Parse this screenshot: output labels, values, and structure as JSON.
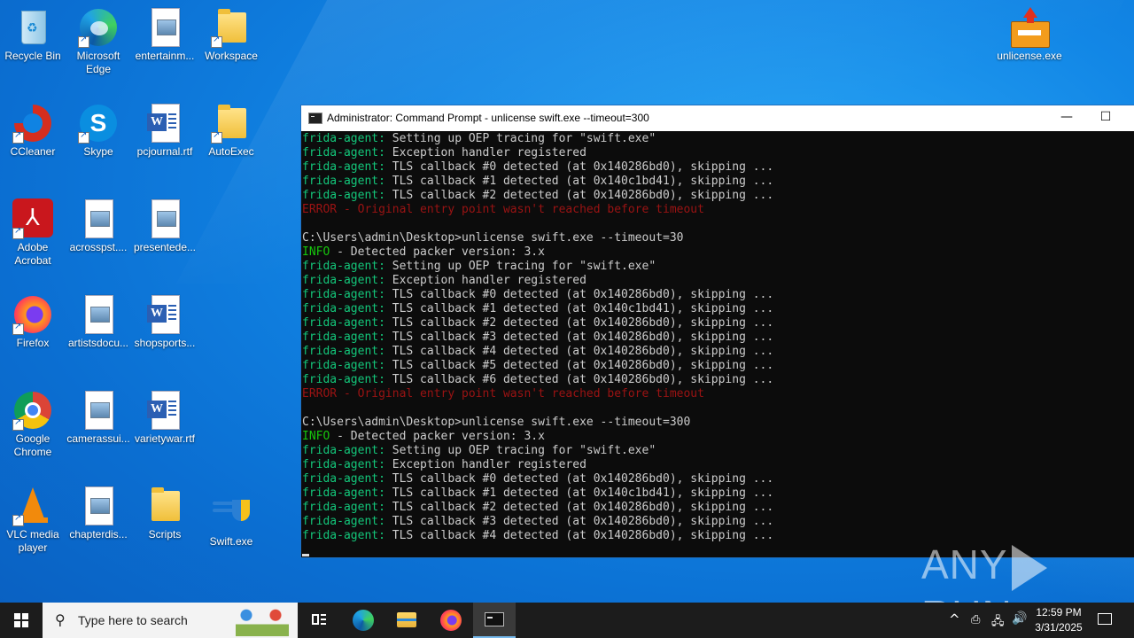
{
  "desktop": {
    "icons": [
      {
        "label": "Recycle Bin"
      },
      {
        "label": "Microsoft Edge"
      },
      {
        "label": "entertainm..."
      },
      {
        "label": "Workspace"
      },
      {
        "label": "CCleaner"
      },
      {
        "label": "Skype"
      },
      {
        "label": "pcjournal.rtf"
      },
      {
        "label": "AutoExec"
      },
      {
        "label": "Adobe Acrobat"
      },
      {
        "label": "acrosspst...."
      },
      {
        "label": "presentede..."
      },
      {
        "label": "Firefox"
      },
      {
        "label": "artistsdocu..."
      },
      {
        "label": "shopsports..."
      },
      {
        "label": "Google Chrome"
      },
      {
        "label": "camerassui..."
      },
      {
        "label": "varietywar.rtf"
      },
      {
        "label": "VLC media player"
      },
      {
        "label": "chapterdis..."
      },
      {
        "label": "Scripts"
      },
      {
        "label": "Swift.exe"
      },
      {
        "label": "unlicense.exe"
      }
    ]
  },
  "cmd_window": {
    "title": "Administrator: Command Prompt - unlicense  swift.exe --timeout=300",
    "minimize": "—",
    "maximize": "☐",
    "lines": [
      {
        "prefix": "frida-agent:",
        "text": " Setting up OEP tracing for \"swift.exe\"",
        "type": "agent"
      },
      {
        "prefix": "frida-agent:",
        "text": " Exception handler registered",
        "type": "agent"
      },
      {
        "prefix": "frida-agent:",
        "text": " TLS callback #0 detected (at 0x140286bd0), skipping ...",
        "type": "agent"
      },
      {
        "prefix": "frida-agent:",
        "text": " TLS callback #1 detected (at 0x140c1bd41), skipping ...",
        "type": "agent"
      },
      {
        "prefix": "frida-agent:",
        "text": " TLS callback #2 detected (at 0x140286bd0), skipping ...",
        "type": "agent"
      },
      {
        "prefix": "",
        "text": "ERROR - Original entry point wasn't reached before timeout",
        "type": "error"
      },
      {
        "prefix": "",
        "text": "",
        "type": "plain"
      },
      {
        "prefix": "",
        "text": "C:\\Users\\admin\\Desktop>unlicense swift.exe --timeout=30",
        "type": "plain"
      },
      {
        "prefix": "INFO",
        "text": " - Detected packer version: 3.x",
        "type": "info"
      },
      {
        "prefix": "frida-agent:",
        "text": " Setting up OEP tracing for \"swift.exe\"",
        "type": "agent"
      },
      {
        "prefix": "frida-agent:",
        "text": " Exception handler registered",
        "type": "agent"
      },
      {
        "prefix": "frida-agent:",
        "text": " TLS callback #0 detected (at 0x140286bd0), skipping ...",
        "type": "agent"
      },
      {
        "prefix": "frida-agent:",
        "text": " TLS callback #1 detected (at 0x140c1bd41), skipping ...",
        "type": "agent"
      },
      {
        "prefix": "frida-agent:",
        "text": " TLS callback #2 detected (at 0x140286bd0), skipping ...",
        "type": "agent"
      },
      {
        "prefix": "frida-agent:",
        "text": " TLS callback #3 detected (at 0x140286bd0), skipping ...",
        "type": "agent"
      },
      {
        "prefix": "frida-agent:",
        "text": " TLS callback #4 detected (at 0x140286bd0), skipping ...",
        "type": "agent"
      },
      {
        "prefix": "frida-agent:",
        "text": " TLS callback #5 detected (at 0x140286bd0), skipping ...",
        "type": "agent"
      },
      {
        "prefix": "frida-agent:",
        "text": " TLS callback #6 detected (at 0x140286bd0), skipping ...",
        "type": "agent"
      },
      {
        "prefix": "",
        "text": "ERROR - Original entry point wasn't reached before timeout",
        "type": "error"
      },
      {
        "prefix": "",
        "text": "",
        "type": "plain"
      },
      {
        "prefix": "",
        "text": "C:\\Users\\admin\\Desktop>unlicense swift.exe --timeout=300",
        "type": "plain"
      },
      {
        "prefix": "INFO",
        "text": " - Detected packer version: 3.x",
        "type": "info"
      },
      {
        "prefix": "frida-agent:",
        "text": " Setting up OEP tracing for \"swift.exe\"",
        "type": "agent"
      },
      {
        "prefix": "frida-agent:",
        "text": " Exception handler registered",
        "type": "agent"
      },
      {
        "prefix": "frida-agent:",
        "text": " TLS callback #0 detected (at 0x140286bd0), skipping ...",
        "type": "agent"
      },
      {
        "prefix": "frida-agent:",
        "text": " TLS callback #1 detected (at 0x140c1bd41), skipping ...",
        "type": "agent"
      },
      {
        "prefix": "frida-agent:",
        "text": " TLS callback #2 detected (at 0x140286bd0), skipping ...",
        "type": "agent"
      },
      {
        "prefix": "frida-agent:",
        "text": " TLS callback #3 detected (at 0x140286bd0), skipping ...",
        "type": "agent"
      },
      {
        "prefix": "frida-agent:",
        "text": " TLS callback #4 detected (at 0x140286bd0), skipping ...",
        "type": "agent"
      }
    ]
  },
  "watermark": {
    "left": "ANY",
    "right": "RUN"
  },
  "taskbar": {
    "search_placeholder": "Type here to search",
    "clock_time": "12:59 PM",
    "clock_date": "3/31/2025"
  },
  "colors": {
    "agent": "#13c67a",
    "info": "#16c60c",
    "error": "#9b1313",
    "taskbar": "#1c1c1c"
  }
}
